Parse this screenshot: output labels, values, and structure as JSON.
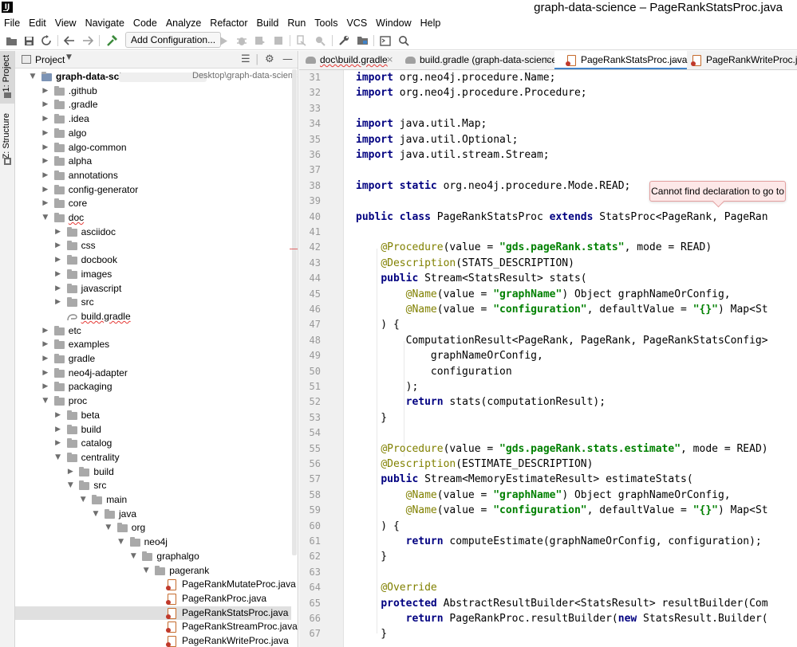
{
  "window": {
    "title": "graph-data-science – PageRankStatsProc.java"
  },
  "menu": [
    "File",
    "Edit",
    "View",
    "Navigate",
    "Code",
    "Analyze",
    "Refactor",
    "Build",
    "Run",
    "Tools",
    "VCS",
    "Window",
    "Help"
  ],
  "toolbar": {
    "add_configuration": "Add Configuration...",
    "icons": [
      "open-icon",
      "save-icon",
      "sync-icon",
      "back-icon",
      "forward-icon",
      "build-hammer-icon",
      "run-icon",
      "debug-icon",
      "coverage-icon",
      "stop-icon",
      "attach-icon",
      "profile-icon",
      "settings-wrench-icon",
      "project-structure-icon",
      "terminal-icon",
      "search-icon"
    ]
  },
  "left_stripe": {
    "project": "1: Project",
    "structure": "Z: Structure"
  },
  "project_panel": {
    "title": "Project",
    "tree": [
      {
        "label": "graph-data-science",
        "path": "Desktop\\graph-data-science",
        "depth": 0,
        "type": "root",
        "expanded": true
      },
      {
        "label": ".github",
        "depth": 1,
        "type": "folder"
      },
      {
        "label": ".gradle",
        "depth": 1,
        "type": "folder"
      },
      {
        "label": ".idea",
        "depth": 1,
        "type": "folder"
      },
      {
        "label": "algo",
        "depth": 1,
        "type": "folder"
      },
      {
        "label": "algo-common",
        "depth": 1,
        "type": "folder"
      },
      {
        "label": "alpha",
        "depth": 1,
        "type": "folder"
      },
      {
        "label": "annotations",
        "depth": 1,
        "type": "folder"
      },
      {
        "label": "config-generator",
        "depth": 1,
        "type": "folder"
      },
      {
        "label": "core",
        "depth": 1,
        "type": "folder"
      },
      {
        "label": "doc",
        "depth": 1,
        "type": "folder",
        "expanded": true,
        "squiggle": true
      },
      {
        "label": "asciidoc",
        "depth": 2,
        "type": "folder"
      },
      {
        "label": "css",
        "depth": 2,
        "type": "folder"
      },
      {
        "label": "docbook",
        "depth": 2,
        "type": "folder"
      },
      {
        "label": "images",
        "depth": 2,
        "type": "folder"
      },
      {
        "label": "javascript",
        "depth": 2,
        "type": "folder"
      },
      {
        "label": "src",
        "depth": 2,
        "type": "folder"
      },
      {
        "label": "build.gradle",
        "depth": 2,
        "type": "gradle",
        "squiggle": true
      },
      {
        "label": "etc",
        "depth": 1,
        "type": "folder"
      },
      {
        "label": "examples",
        "depth": 1,
        "type": "folder"
      },
      {
        "label": "gradle",
        "depth": 1,
        "type": "folder"
      },
      {
        "label": "neo4j-adapter",
        "depth": 1,
        "type": "folder"
      },
      {
        "label": "packaging",
        "depth": 1,
        "type": "folder"
      },
      {
        "label": "proc",
        "depth": 1,
        "type": "folder",
        "expanded": true
      },
      {
        "label": "beta",
        "depth": 2,
        "type": "folder"
      },
      {
        "label": "build",
        "depth": 2,
        "type": "folder"
      },
      {
        "label": "catalog",
        "depth": 2,
        "type": "folder"
      },
      {
        "label": "centrality",
        "depth": 2,
        "type": "folder",
        "expanded": true
      },
      {
        "label": "build",
        "depth": 3,
        "type": "folder"
      },
      {
        "label": "src",
        "depth": 3,
        "type": "folder",
        "expanded": true
      },
      {
        "label": "main",
        "depth": 4,
        "type": "folder",
        "expanded": true
      },
      {
        "label": "java",
        "depth": 5,
        "type": "folder",
        "expanded": true
      },
      {
        "label": "org",
        "depth": 6,
        "type": "folder",
        "expanded": true
      },
      {
        "label": "neo4j",
        "depth": 7,
        "type": "folder",
        "expanded": true
      },
      {
        "label": "graphalgo",
        "depth": 8,
        "type": "folder",
        "expanded": true
      },
      {
        "label": "pagerank",
        "depth": 9,
        "type": "folder",
        "expanded": true
      },
      {
        "label": "PageRankMutateProc.java",
        "depth": 10,
        "type": "java"
      },
      {
        "label": "PageRankProc.java",
        "depth": 10,
        "type": "java"
      },
      {
        "label": "PageRankStatsProc.java",
        "depth": 10,
        "type": "java",
        "selected": true
      },
      {
        "label": "PageRankStreamProc.java",
        "depth": 10,
        "type": "java"
      },
      {
        "label": "PageRankWriteProc.java",
        "depth": 10,
        "type": "java"
      }
    ]
  },
  "tabs": [
    {
      "label": "doc\\build.gradle",
      "type": "gradle",
      "squiggle": true
    },
    {
      "label": "build.gradle (graph-data-science)",
      "type": "gradle"
    },
    {
      "label": "PageRankStatsProc.java",
      "type": "java",
      "active": true
    },
    {
      "label": "PageRankWriteProc.java",
      "type": "java"
    }
  ],
  "editor": {
    "tooltip": "Cannot find declaration to go to",
    "lines": [
      {
        "n": "31",
        "code": [
          [
            "kw",
            "import"
          ],
          [
            "t",
            " org.neo4j.procedure.Name;"
          ]
        ]
      },
      {
        "n": "32",
        "code": [
          [
            "kw",
            "import"
          ],
          [
            "t",
            " org.neo4j.procedure.Procedure;"
          ]
        ]
      },
      {
        "n": "33",
        "code": []
      },
      {
        "n": "34",
        "code": [
          [
            "kw",
            "import"
          ],
          [
            "t",
            " java.util.Map;"
          ]
        ]
      },
      {
        "n": "35",
        "code": [
          [
            "kw",
            "import"
          ],
          [
            "t",
            " java.util.Optional;"
          ]
        ]
      },
      {
        "n": "36",
        "code": [
          [
            "kw",
            "import"
          ],
          [
            "t",
            " java.util.stream.Stream;"
          ]
        ]
      },
      {
        "n": "37",
        "code": []
      },
      {
        "n": "38",
        "code": [
          [
            "kw",
            "import static"
          ],
          [
            "t",
            " org.neo4j.procedure.Mode.READ;"
          ]
        ]
      },
      {
        "n": "39",
        "code": []
      },
      {
        "n": "40",
        "code": [
          [
            "kw",
            "public class"
          ],
          [
            "t",
            " PageRankStatsProc "
          ],
          [
            "kw",
            "extends"
          ],
          [
            "t",
            " StatsProc<PageRank, PageRan"
          ]
        ]
      },
      {
        "n": "41",
        "code": []
      },
      {
        "n": "42",
        "code": [
          [
            "t",
            "    "
          ],
          [
            "ann",
            "@Procedure"
          ],
          [
            "t",
            "(value = "
          ],
          [
            "str",
            "\"gds.pageRank.stats\""
          ],
          [
            "t",
            ", mode = READ)"
          ]
        ]
      },
      {
        "n": "43",
        "code": [
          [
            "t",
            "    "
          ],
          [
            "ann",
            "@Description"
          ],
          [
            "t",
            "(STATS_DESCRIPTION)"
          ]
        ]
      },
      {
        "n": "44",
        "code": [
          [
            "t",
            "    "
          ],
          [
            "kw",
            "public"
          ],
          [
            "t",
            " Stream<StatsResult> stats("
          ]
        ]
      },
      {
        "n": "45",
        "code": [
          [
            "t",
            "        "
          ],
          [
            "ann",
            "@Name"
          ],
          [
            "t",
            "(value = "
          ],
          [
            "str",
            "\"graphName\""
          ],
          [
            "t",
            ") Object graphNameOrConfig,"
          ]
        ]
      },
      {
        "n": "46",
        "code": [
          [
            "t",
            "        "
          ],
          [
            "ann",
            "@Name"
          ],
          [
            "t",
            "(value = "
          ],
          [
            "str",
            "\"configuration\""
          ],
          [
            "t",
            ", defaultValue = "
          ],
          [
            "str",
            "\"{}\""
          ],
          [
            "t",
            ") Map<St"
          ]
        ]
      },
      {
        "n": "47",
        "code": [
          [
            "t",
            "    ) {"
          ]
        ]
      },
      {
        "n": "48",
        "code": [
          [
            "t",
            "        ComputationResult<PageRank, PageRank, PageRankStatsConfig>"
          ]
        ]
      },
      {
        "n": "49",
        "code": [
          [
            "t",
            "            graphNameOrConfig,"
          ]
        ]
      },
      {
        "n": "50",
        "code": [
          [
            "t",
            "            configuration"
          ]
        ]
      },
      {
        "n": "51",
        "code": [
          [
            "t",
            "        );"
          ]
        ]
      },
      {
        "n": "52",
        "code": [
          [
            "t",
            "        "
          ],
          [
            "kw",
            "return"
          ],
          [
            "t",
            " stats(computationResult);"
          ]
        ]
      },
      {
        "n": "53",
        "code": [
          [
            "t",
            "    }"
          ]
        ]
      },
      {
        "n": "54",
        "code": []
      },
      {
        "n": "55",
        "code": [
          [
            "t",
            "    "
          ],
          [
            "ann",
            "@Procedure"
          ],
          [
            "t",
            "(value = "
          ],
          [
            "str",
            "\"gds.pageRank.stats.estimate\""
          ],
          [
            "t",
            ", mode = READ)"
          ]
        ]
      },
      {
        "n": "56",
        "code": [
          [
            "t",
            "    "
          ],
          [
            "ann",
            "@Description"
          ],
          [
            "t",
            "(ESTIMATE_DESCRIPTION)"
          ]
        ]
      },
      {
        "n": "57",
        "code": [
          [
            "t",
            "    "
          ],
          [
            "kw",
            "public"
          ],
          [
            "t",
            " Stream<MemoryEstimateResult> estimateStats("
          ]
        ]
      },
      {
        "n": "58",
        "code": [
          [
            "t",
            "        "
          ],
          [
            "ann",
            "@Name"
          ],
          [
            "t",
            "(value = "
          ],
          [
            "str",
            "\"graphName\""
          ],
          [
            "t",
            ") Object graphNameOrConfig,"
          ]
        ]
      },
      {
        "n": "59",
        "code": [
          [
            "t",
            "        "
          ],
          [
            "ann",
            "@Name"
          ],
          [
            "t",
            "(value = "
          ],
          [
            "str",
            "\"configuration\""
          ],
          [
            "t",
            ", defaultValue = "
          ],
          [
            "str",
            "\"{}\""
          ],
          [
            "t",
            ") Map<St"
          ]
        ]
      },
      {
        "n": "60",
        "code": [
          [
            "t",
            "    ) {"
          ]
        ]
      },
      {
        "n": "61",
        "code": [
          [
            "t",
            "        "
          ],
          [
            "kw",
            "return"
          ],
          [
            "t",
            " computeEstimate(graphNameOrConfig, configuration);"
          ]
        ]
      },
      {
        "n": "62",
        "code": [
          [
            "t",
            "    }"
          ]
        ]
      },
      {
        "n": "63",
        "code": []
      },
      {
        "n": "64",
        "code": [
          [
            "t",
            "    "
          ],
          [
            "ann",
            "@Override"
          ]
        ]
      },
      {
        "n": "65",
        "code": [
          [
            "t",
            "    "
          ],
          [
            "kw",
            "protected"
          ],
          [
            "t",
            " AbstractResultBuilder<StatsResult> resultBuilder(Com"
          ]
        ]
      },
      {
        "n": "66",
        "code": [
          [
            "t",
            "        "
          ],
          [
            "kw",
            "return"
          ],
          [
            "t",
            " PageRankProc.resultBuilder("
          ],
          [
            "kw",
            "new"
          ],
          [
            "t",
            " StatsResult.Builder("
          ]
        ]
      },
      {
        "n": "67",
        "code": [
          [
            "t",
            "    }"
          ]
        ]
      }
    ]
  },
  "colors": {
    "keyword": "#000080",
    "string": "#008000",
    "annotation": "#808000",
    "accent": "#4083c9"
  }
}
